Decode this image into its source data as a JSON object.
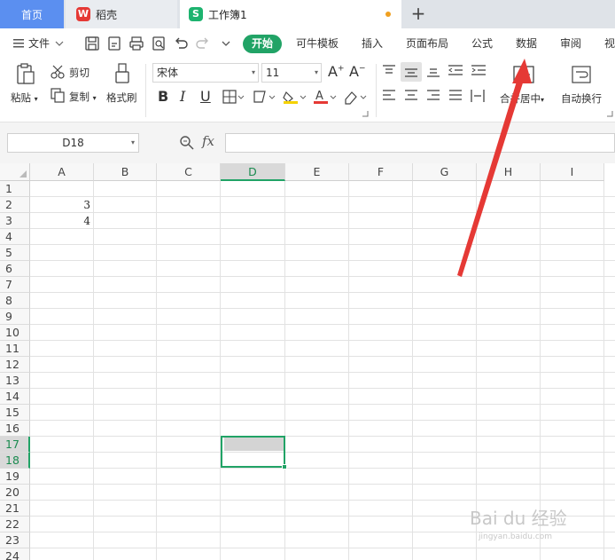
{
  "tabs": {
    "home": "首页",
    "daoke": "稻壳",
    "doc": "工作簿1",
    "plus": "+"
  },
  "menu": {
    "file": "文件",
    "items": [
      "开始",
      "可牛模板",
      "插入",
      "页面布局",
      "公式",
      "数据",
      "审阅",
      "视"
    ]
  },
  "ribbon": {
    "paste": "粘贴",
    "cut": "剪切",
    "copy": "复制",
    "format_painter": "格式刷",
    "font_name": "宋体",
    "font_size": "11",
    "bold": "B",
    "italic": "I",
    "underline": "U",
    "merge_center": "合并居中",
    "auto_wrap": "自动换行"
  },
  "formula_bar": {
    "name_box": "D18",
    "fx": "fx",
    "value": ""
  },
  "sheet": {
    "columns": [
      "A",
      "B",
      "C",
      "D",
      "E",
      "F",
      "G",
      "H",
      "I"
    ],
    "rows": [
      "1",
      "2",
      "3",
      "4",
      "5",
      "6",
      "7",
      "8",
      "9",
      "10",
      "11",
      "12",
      "13",
      "14",
      "15",
      "16",
      "17",
      "18",
      "19",
      "20",
      "21",
      "22",
      "23",
      "24"
    ],
    "active_column": "D",
    "active_rows": [
      "17",
      "18"
    ],
    "cells": {
      "A2": "3",
      "A3": "4"
    }
  },
  "colors": {
    "accent": "#21a366",
    "home_tab": "#5b8ff0",
    "arrow": "#e53935"
  },
  "watermark": {
    "text": "Bai du 经验",
    "sub": "jingyan.baidu.com"
  }
}
